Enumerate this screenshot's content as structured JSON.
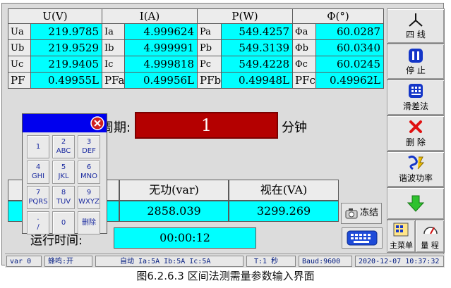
{
  "table": {
    "headers": [
      "U(V)",
      "I(A)",
      "P(W)",
      "Φ(°)"
    ],
    "rows": [
      [
        "Ua",
        "219.9785",
        "Ia",
        "4.999624",
        "Pa",
        "549.4257",
        "Φa",
        "60.0287"
      ],
      [
        "Ub",
        "219.9529",
        "Ib",
        "4.999991",
        "Pb",
        "549.3139",
        "Φb",
        "60.0340"
      ],
      [
        "Uc",
        "219.9405",
        "Ic",
        "4.999818",
        "Pc",
        "549.4228",
        "Φc",
        "60.0245"
      ],
      [
        "PF",
        "0.49955L",
        "PFa",
        "0.49956L",
        "PFb",
        "0.49948L",
        "PFc",
        "0.49962L"
      ]
    ]
  },
  "period": {
    "label": "周期:",
    "value": "1",
    "unit": "分钟"
  },
  "power": {
    "reactive_label": "无功(var)",
    "reactive_value": "2858.039",
    "apparent_label": "视在(VA)",
    "apparent_value": "3299.269"
  },
  "runtime": {
    "label": "运行时间:",
    "value": "00:00:12"
  },
  "freeze_label": "冻结",
  "sidebar": {
    "items": [
      {
        "label": "四 线",
        "icon": "three-wire-star-icon"
      },
      {
        "label": "停 止",
        "icon": "pause-icon"
      },
      {
        "label": "滑差法",
        "icon": "calculator-icon"
      },
      {
        "label": "删 除",
        "icon": "delete-x-icon"
      },
      {
        "label": "谐波功率",
        "icon": "harmonic-icon"
      },
      {
        "label": "",
        "icon": "arrow-down-icon"
      }
    ],
    "main_menu": "主菜单",
    "range": "量 程"
  },
  "keypad": {
    "keys": [
      {
        "num": "1",
        "letters": ""
      },
      {
        "num": "2",
        "letters": "ABC"
      },
      {
        "num": "3",
        "letters": "DEF"
      },
      {
        "num": "4",
        "letters": "GHI"
      },
      {
        "num": "5",
        "letters": "JKL"
      },
      {
        "num": "6",
        "letters": "MNO"
      },
      {
        "num": "7",
        "letters": "PQRS"
      },
      {
        "num": "8",
        "letters": "TUV"
      },
      {
        "num": "9",
        "letters": "WXYZ"
      },
      {
        "num": ".",
        "letters": "/"
      },
      {
        "num": "0",
        "letters": ""
      },
      {
        "num": "删除",
        "letters": ""
      }
    ]
  },
  "status": {
    "var": "var 0",
    "buzzer": "蜂鸣:开",
    "range": "自动 Ia:5A Ib:5A Ic:5A",
    "t": "T:1 秒",
    "baud": "Baud:9600",
    "datetime": "2020-12-07 10:37:32"
  },
  "caption": "图6.2.6.3   区间法测需量参数输入界面"
}
